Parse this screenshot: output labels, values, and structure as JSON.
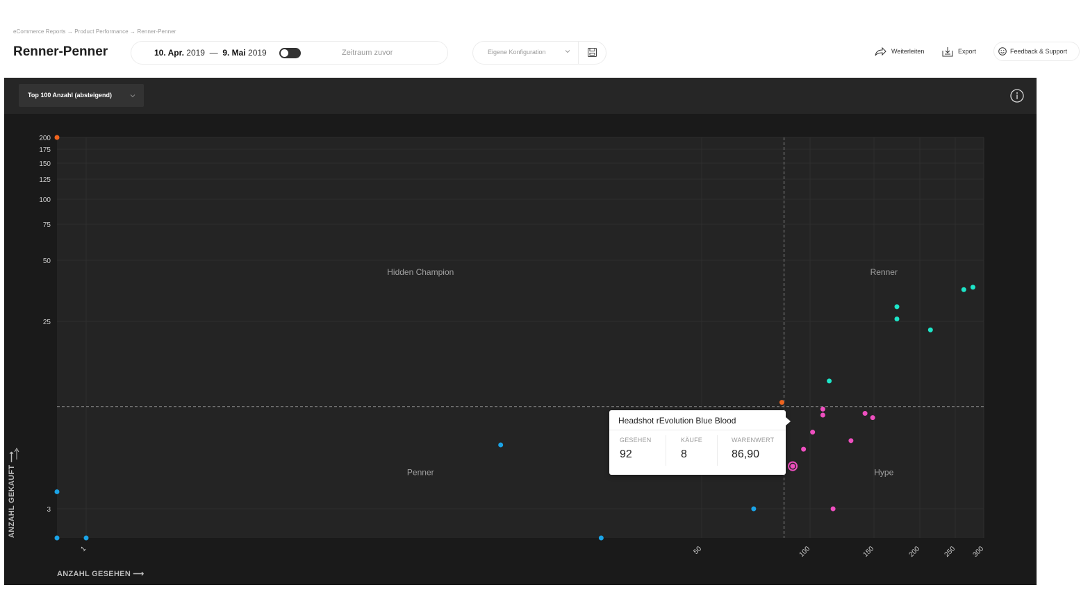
{
  "breadcrumb": "eCommerce Reports → Product Performance → Renner-Penner",
  "page_title": "Renner-Penner",
  "date_range": {
    "start": "10. Apr.",
    "start_year": "2019",
    "separator": "—",
    "end": "9. Mai",
    "end_year": "2019"
  },
  "compare": {
    "label": "Zeitraum zuvor",
    "enabled": false
  },
  "config": {
    "label": "Eigene Konfiguration"
  },
  "actions": {
    "forward": "Weiterleiten",
    "export": "Export",
    "feedback": "Feedback & Support"
  },
  "chart_controls": {
    "sort_label": "Top 100 Anzahl (absteigend)"
  },
  "colors": {
    "hype": "#ee4fbf",
    "renner": "#1de5c8",
    "penner": "#1aa3e6",
    "hidden_champion": "#f0641e",
    "panel_bg": "#1a1a1a",
    "plot_bg": "#242424"
  },
  "chart_data": {
    "type": "scatter",
    "xlabel": "ANZAHL GESEHEN ⟶",
    "ylabel": "ANZAHL GEKAUFT ⟶",
    "x_ticks": [
      "1",
      "50",
      "100",
      "150",
      "200",
      "250",
      "300"
    ],
    "y_ticks": [
      "200",
      "175",
      "150",
      "125",
      "100",
      "75",
      "50",
      "25",
      "3"
    ],
    "x_threshold": 88,
    "y_threshold": 15,
    "quadrants": [
      "Hidden Champion",
      "Renner",
      "Penner",
      "Hype"
    ],
    "series": [
      {
        "name": "Renner",
        "color": "#1de5c8",
        "points": [
          [
            281,
            39
          ],
          [
            265,
            38
          ],
          [
            175,
            31
          ],
          [
            175,
            26
          ],
          [
            215,
            24
          ],
          [
            115,
            18
          ]
        ]
      },
      {
        "name": "Hype",
        "color": "#ee4fbf",
        "points": [
          [
            110,
            14.7
          ],
          [
            110,
            14
          ],
          [
            143,
            14.2
          ],
          [
            149,
            13.7
          ],
          [
            102,
            12
          ],
          [
            132,
            11
          ],
          [
            97,
            10
          ],
          [
            92,
            8
          ],
          [
            118,
            3
          ]
        ]
      },
      {
        "name": "Hidden Champion",
        "color": "#f0641e",
        "points": [
          [
            0.6,
            200
          ],
          [
            87,
            15.5
          ]
        ]
      },
      {
        "name": "Penner",
        "color": "#1aa3e6",
        "points": [
          [
            34,
            10.5
          ],
          [
            43,
            10
          ],
          [
            75,
            11
          ],
          [
            80,
            10.5
          ],
          [
            67,
            9
          ],
          [
            0.6,
            5
          ],
          [
            0.6,
            2
          ],
          [
            1,
            2
          ],
          [
            42,
            2
          ],
          [
            74,
            3
          ]
        ]
      }
    ],
    "grid": true
  },
  "tooltip": {
    "title": "Headshot rEvolution Blue Blood",
    "cols": [
      {
        "key": "GESEHEN",
        "value": "92"
      },
      {
        "key": "KÄUFE",
        "value": "8"
      },
      {
        "key": "WARENWERT",
        "value": "86,90"
      }
    ]
  }
}
